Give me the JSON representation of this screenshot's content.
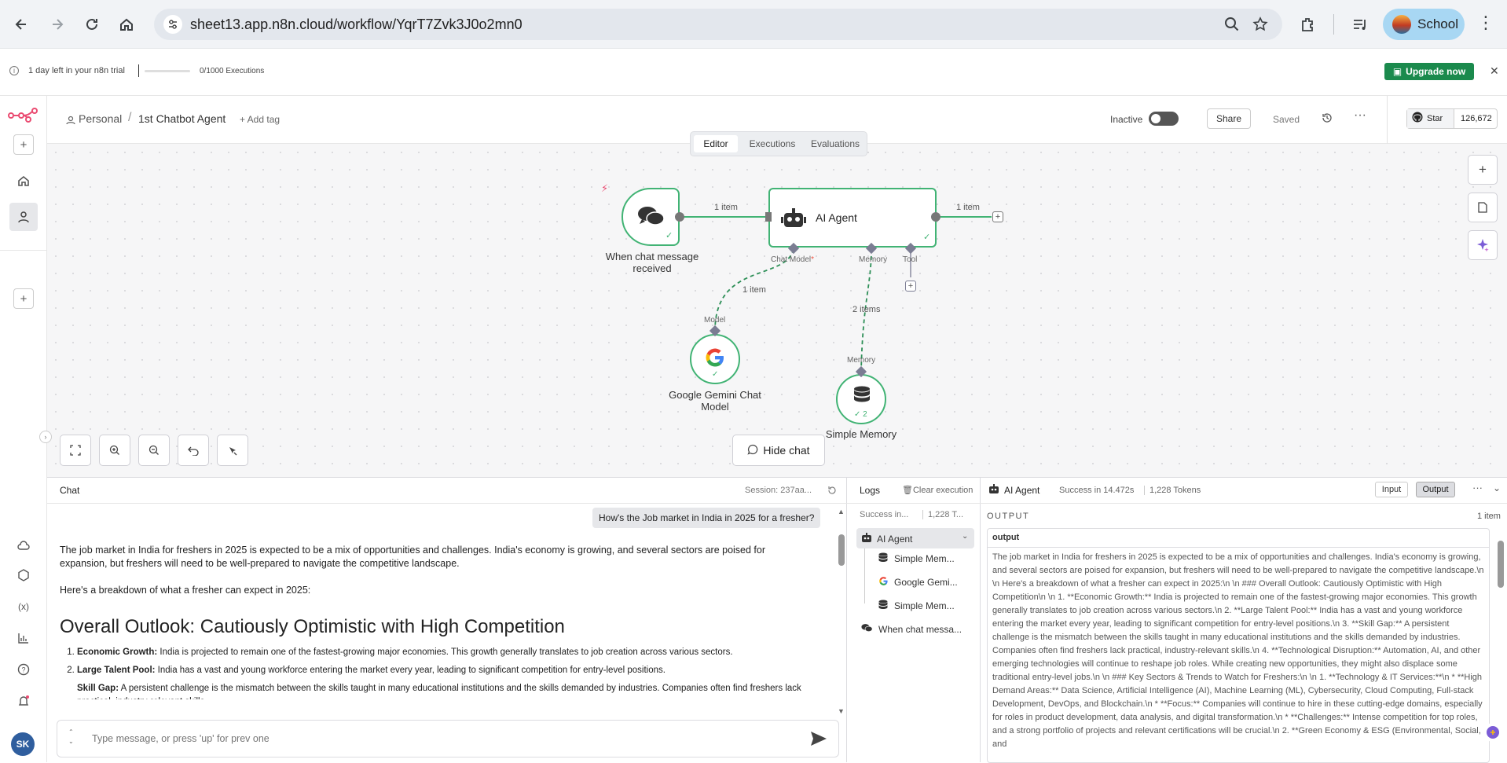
{
  "browser": {
    "url": "sheet13.app.n8n.cloud/workflow/YqrT7Zvk3J0o2mn0",
    "profile_name": "School"
  },
  "trial_bar": {
    "message": "1 day left in your n8n trial",
    "executions": "0/1000 Executions",
    "executions_progress": 0,
    "upgrade_label": "Upgrade now"
  },
  "header": {
    "breadcrumb_root": "Personal",
    "breadcrumb_sep": "/",
    "workflow_name": "1st Chatbot Agent",
    "add_tag": "+ Add tag",
    "status_label": "Inactive",
    "share_label": "Share",
    "saved_label": "Saved",
    "star_label": "Star",
    "star_count": "126,672"
  },
  "tabs": [
    {
      "label": "Editor",
      "active": true
    },
    {
      "label": "Executions",
      "active": false
    },
    {
      "label": "Evaluations",
      "active": false
    }
  ],
  "nodes": {
    "trigger_label_line1": "When chat message",
    "trigger_label_line2": "received",
    "agent_label": "AI Agent",
    "gemini_label_line1": "Google Gemini Chat",
    "gemini_label_line2": "Model",
    "memory_label": "Simple Memory",
    "memory_badge": "2"
  },
  "connections": {
    "trigger_to_agent": "1 item",
    "agent_out": "1 item",
    "model_link": "1 item",
    "memory_link": "2 items",
    "port_chat_model": "Chat Model",
    "port_memory": "Memory",
    "port_tool": "Tool",
    "target_model": "Model",
    "target_memory": "Memory"
  },
  "hide_chat_label": "Hide chat",
  "chat": {
    "title": "Chat",
    "session": "Session: 237aa...",
    "user_message": "How's the Job market in India in 2025 for a fresher?",
    "intro": "The job market in India for freshers in 2025 is expected to be a mix of opportunities and challenges. India's economy is growing, and several sectors are poised for expansion, but freshers will need to be well-prepared to navigate the competitive landscape.",
    "breakdown": "Here's a breakdown of what a fresher can expect in 2025:",
    "heading": "Overall Outlook: Cautiously Optimistic with High Competition",
    "items": [
      {
        "term": "Economic Growth:",
        "text": " India is projected to remain one of the fastest-growing major economies. This growth generally translates to job creation across various sectors."
      },
      {
        "term": "Large Talent Pool:",
        "text": " India has a vast and young workforce entering the market every year, leading to significant competition for entry-level positions."
      },
      {
        "term": "Skill Gap:",
        "text": " A persistent challenge is the mismatch between the skills taught in many educational institutions and the skills demanded by industries. Companies often find freshers lack practical, industry-relevant skills."
      }
    ],
    "input_placeholder": "Type message, or press 'up' for prev one"
  },
  "logs": {
    "title": "Logs",
    "clear_label": "Clear execution",
    "summary_status": "Success in...",
    "summary_tokens": "1,228 T...",
    "entries": [
      {
        "label": "AI Agent",
        "icon": "robot-icon"
      },
      {
        "label": "Simple Mem...",
        "icon": "database-icon"
      },
      {
        "label": "Google Gemi...",
        "icon": "google-icon"
      },
      {
        "label": "Simple Mem...",
        "icon": "database-icon"
      },
      {
        "label": "When chat messa...",
        "icon": "chat-icon"
      }
    ]
  },
  "output_panel": {
    "node_name": "AI Agent",
    "status": "Success in 14.472s",
    "tokens": "1,228 Tokens",
    "input_tab": "Input",
    "output_tab": "Output",
    "section_title": "OUTPUT",
    "item_count": "1 item",
    "field_name": "output",
    "text": "The job market in India for freshers in 2025 is expected to be a mix of opportunities and challenges. India's economy is growing, and several sectors are poised for expansion, but freshers will need to be well-prepared to navigate the competitive landscape.\\n \\n Here's a breakdown of what a fresher can expect in 2025:\\n \\n ### Overall Outlook: Cautiously Optimistic with High Competition\\n \\n 1.  **Economic Growth:** India is projected to remain one of the fastest-growing major economies. This growth generally translates to job creation across various sectors.\\n 2.  **Large Talent Pool:** India has a vast and young workforce entering the market every year, leading to significant competition for entry-level positions.\\n 3.  **Skill Gap:** A persistent challenge is the mismatch between the skills taught in many educational institutions and the skills demanded by industries. Companies often find freshers lack practical, industry-relevant skills.\\n 4.  **Technological Disruption:** Automation, AI, and other emerging technologies will continue to reshape job roles. While creating new opportunities, they might also displace some traditional entry-level jobs.\\n \\n ### Key Sectors & Trends to Watch for Freshers:\\n \\n 1.  **Technology & IT Services:**\\n     *   **High Demand Areas:** Data Science, Artificial Intelligence (AI), Machine Learning (ML), Cybersecurity, Cloud Computing, Full-stack Development, DevOps, and Blockchain.\\n     *   **Focus:** Companies will continue to hire in these cutting-edge domains, especially for roles in product development, data analysis, and digital transformation.\\n     *   **Challenges:** Intense competition for top roles, and a strong portfolio of projects and relevant certifications will be crucial.\\n 2.  **Green Economy & ESG (Environmental, Social, and"
  },
  "user_initials": "SK",
  "colors": {
    "accent": "#41b374",
    "brand": "#ea4b71",
    "upgrade": "#1b8a4d",
    "link_dashed": "#2d8f57"
  }
}
